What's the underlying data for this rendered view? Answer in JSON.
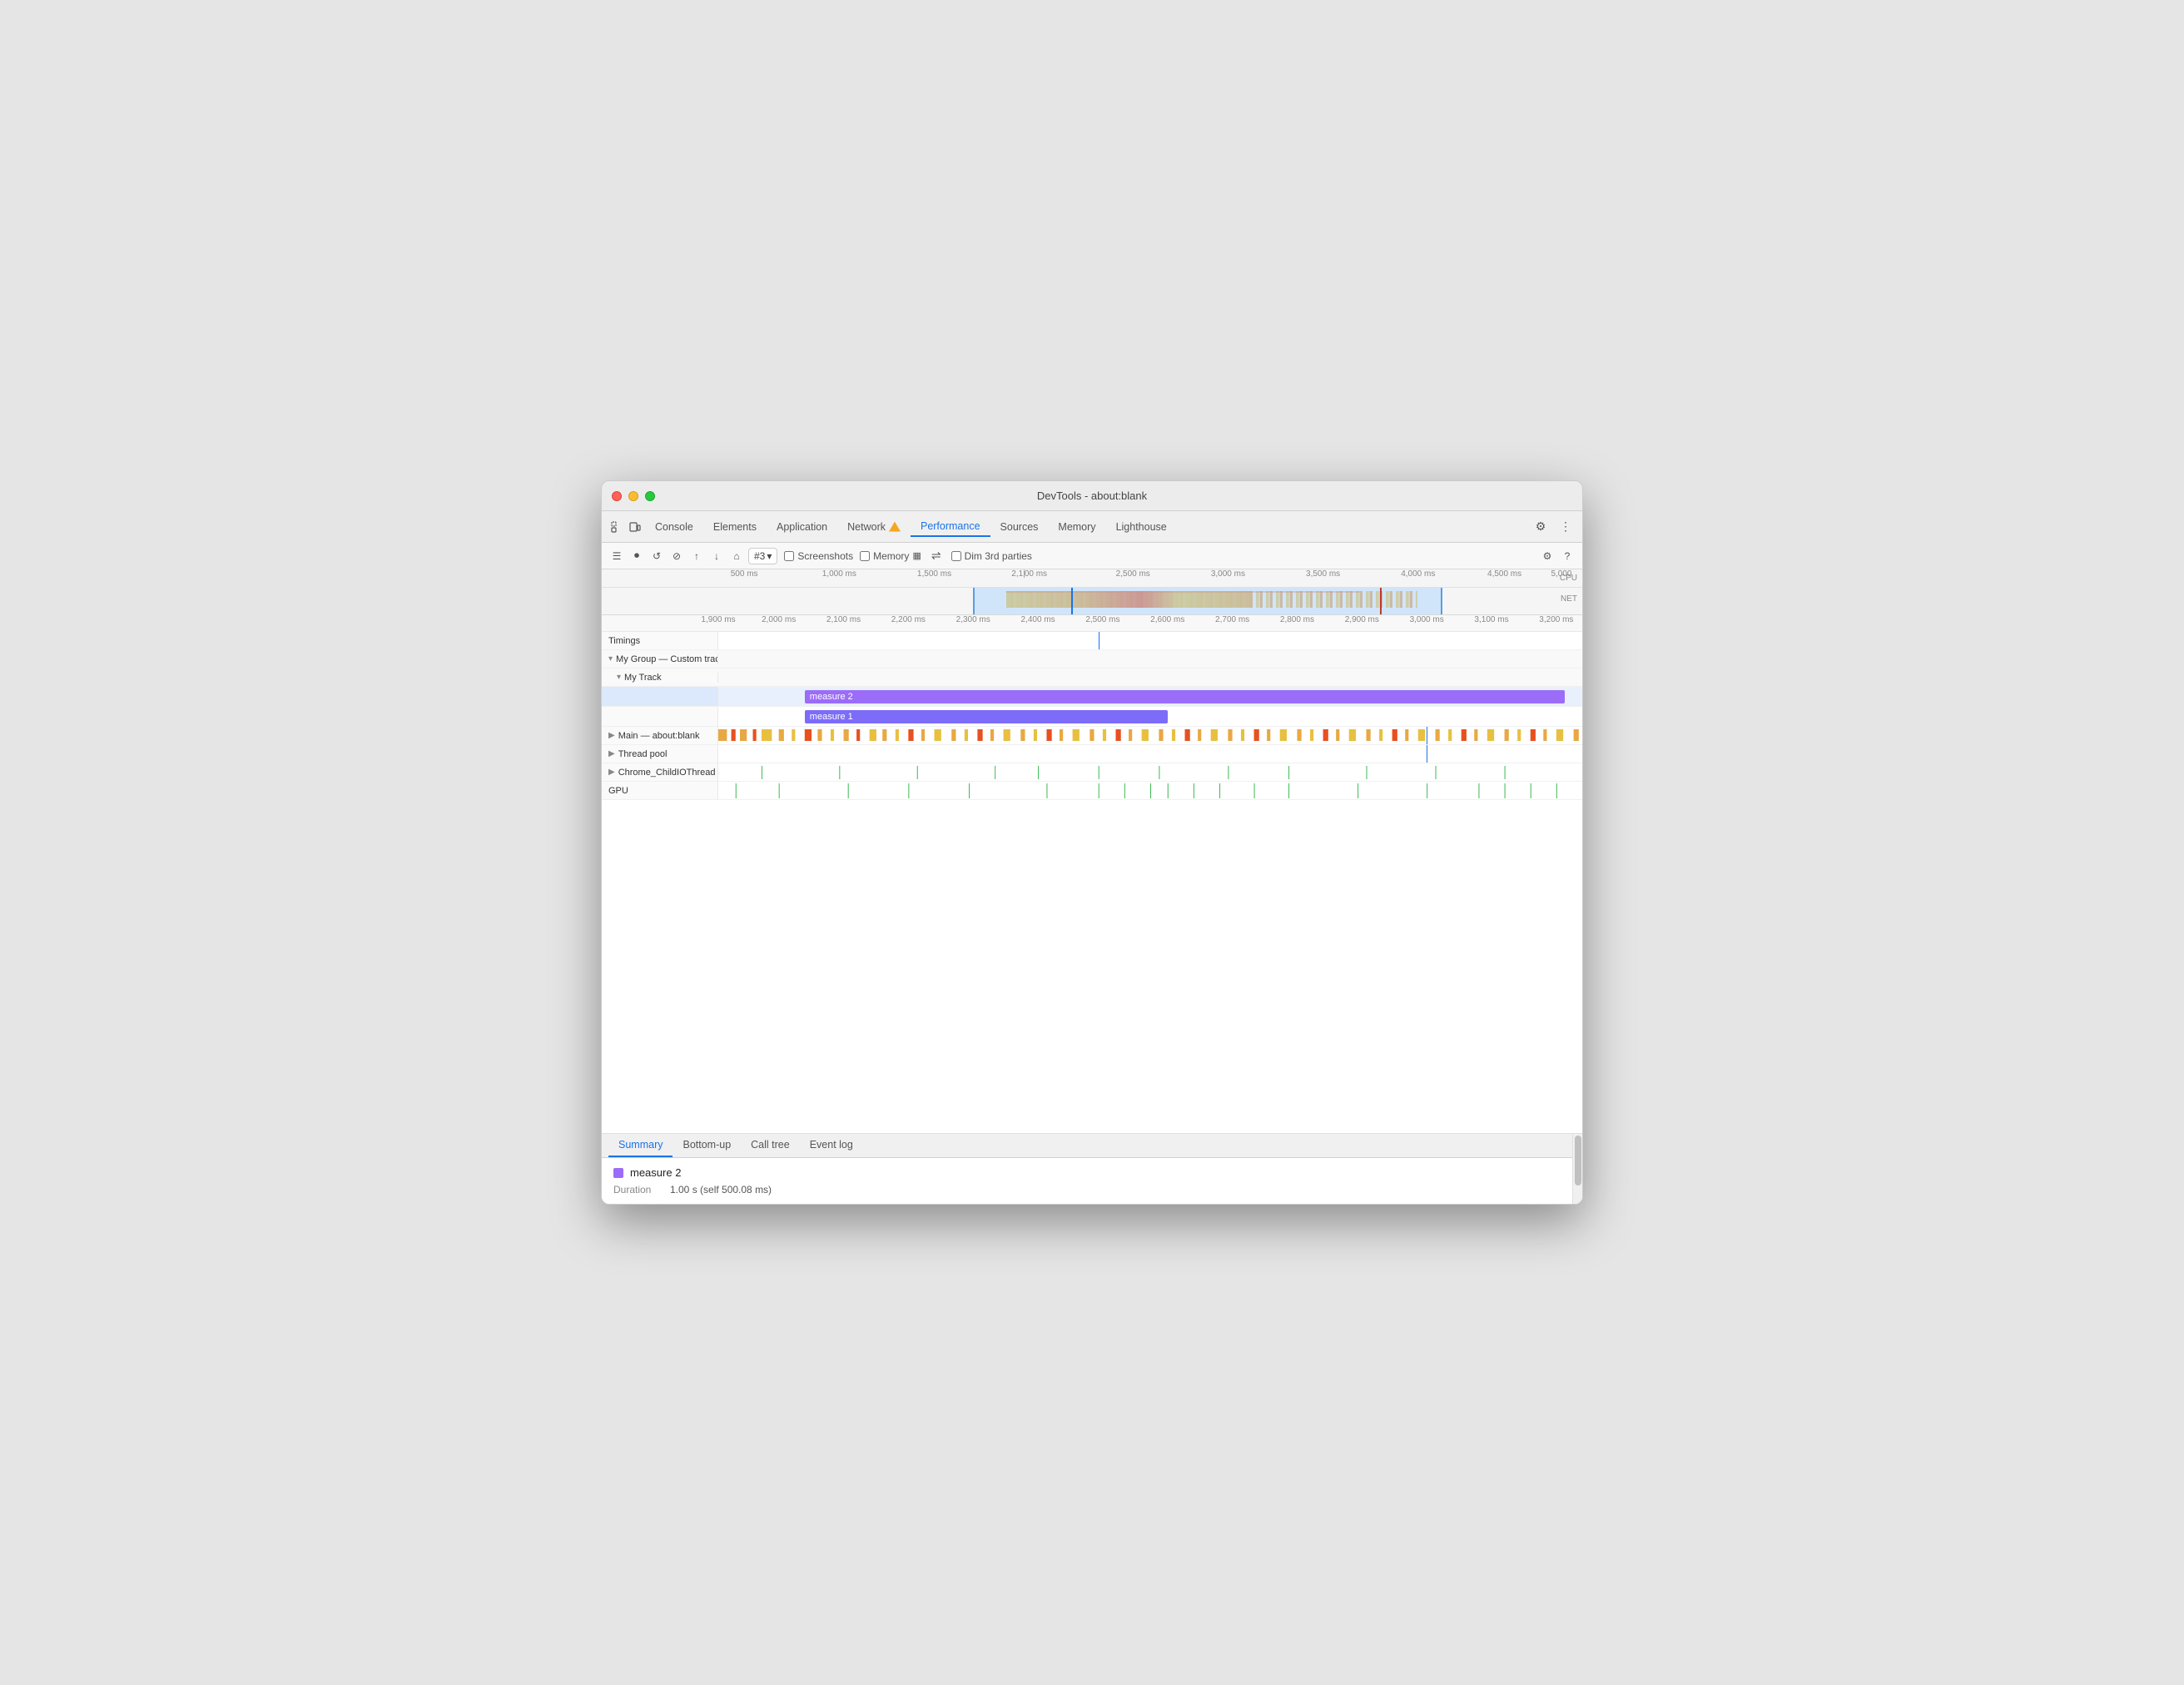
{
  "window": {
    "title": "DevTools - about:blank"
  },
  "tabs": [
    {
      "id": "console",
      "label": "Console",
      "active": false
    },
    {
      "id": "elements",
      "label": "Elements",
      "active": false
    },
    {
      "id": "application",
      "label": "Application",
      "active": false
    },
    {
      "id": "network",
      "label": "Network",
      "active": false,
      "warning": true
    },
    {
      "id": "performance",
      "label": "Performance",
      "active": true
    },
    {
      "id": "sources",
      "label": "Sources",
      "active": false
    },
    {
      "id": "memory",
      "label": "Memory",
      "active": false
    },
    {
      "id": "lighthouse",
      "label": "Lighthouse",
      "active": false
    }
  ],
  "subtoolbar": {
    "record_num": "#3",
    "screenshots_label": "Screenshots",
    "memory_label": "Memory",
    "dim3rd_label": "Dim 3rd parties"
  },
  "overview": {
    "ruler_labels": [
      "500 ms",
      "1,000 ms",
      "1,500 ms",
      "2,100 ms",
      "2,500 ms",
      "3,000 ms",
      "3,500 ms",
      "4,000 ms",
      "4,500 ms",
      "5,000"
    ],
    "cpu_label": "CPU",
    "net_label": "NET"
  },
  "inner_ruler": {
    "labels": [
      "1,900 ms",
      "2,000 ms",
      "2,100 ms",
      "2,200 ms",
      "2,300 ms",
      "2,400 ms",
      "2,500 ms",
      "2,600 ms",
      "2,700 ms",
      "2,800 ms",
      "2,900 ms",
      "3,000 ms",
      "3,100 ms",
      "3,200 ms"
    ]
  },
  "tracks": {
    "timings_label": "Timings",
    "custom_group_label": "My Group — Custom track",
    "my_track_label": "My Track",
    "measure2_label": "measure 2",
    "measure1_label": "measure 1",
    "main_label": "Main — about:blank",
    "thread_pool_label": "Thread pool",
    "chrome_io_label": "Chrome_ChildIOThread",
    "gpu_label": "GPU"
  },
  "bottom_tabs": [
    {
      "id": "summary",
      "label": "Summary",
      "active": true
    },
    {
      "id": "bottom-up",
      "label": "Bottom-up",
      "active": false
    },
    {
      "id": "call-tree",
      "label": "Call tree",
      "active": false
    },
    {
      "id": "event-log",
      "label": "Event log",
      "active": false
    }
  ],
  "summary": {
    "measure_name": "measure 2",
    "duration_label": "Duration",
    "duration_value": "1.00 s (self 500.08 ms)"
  }
}
